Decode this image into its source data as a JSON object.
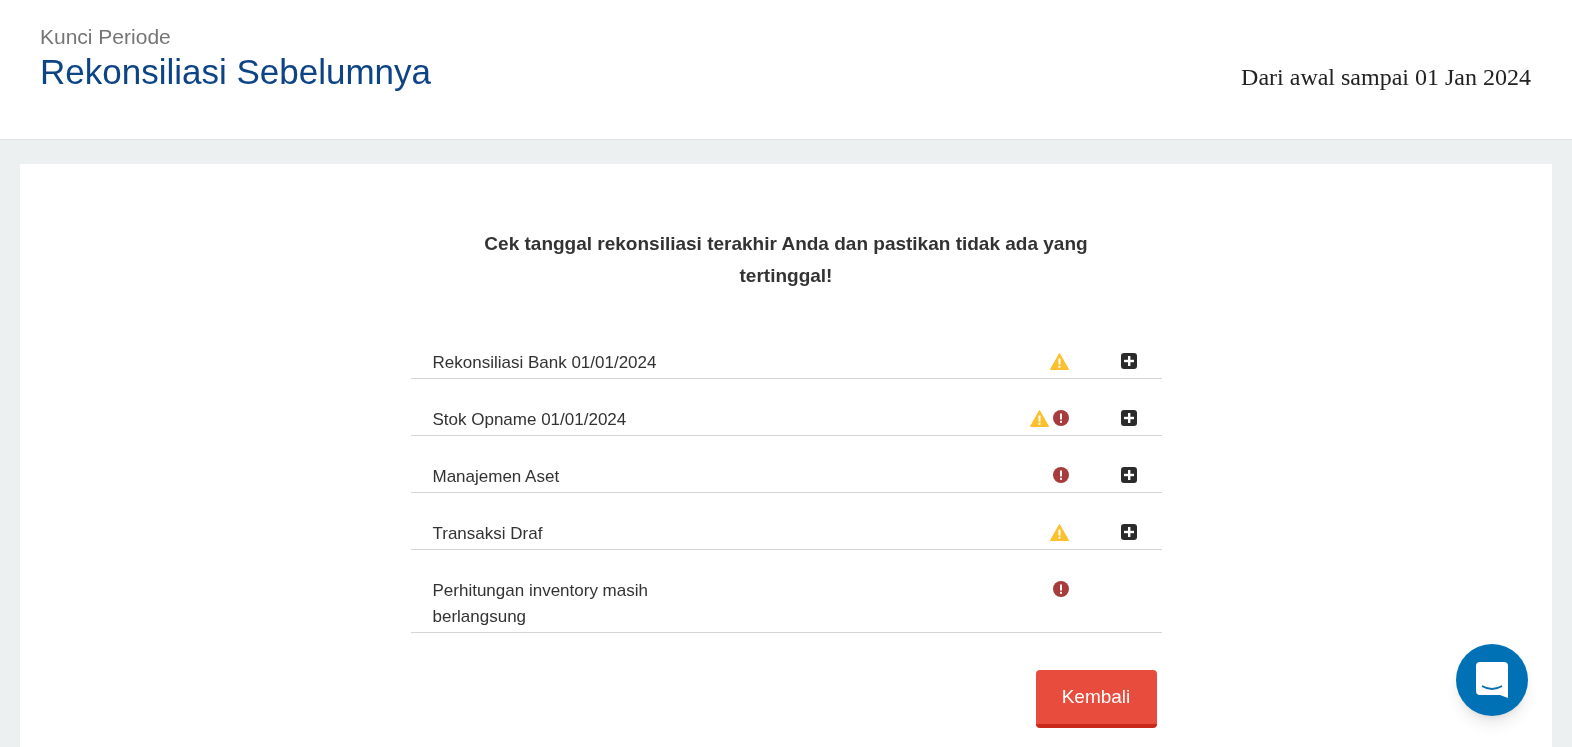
{
  "header": {
    "subtitle": "Kunci Periode",
    "title": "Rekonsiliasi Sebelumnya",
    "date_range": "Dari awal sampai 01 Jan 2024"
  },
  "message": "Cek tanggal rekonsiliasi terakhir Anda dan pastikan tidak ada yang tertinggal!",
  "items": [
    {
      "label": "Rekonsiliasi Bank 01/01/2024",
      "warning": true,
      "error": false,
      "expandable": true
    },
    {
      "label": "Stok Opname 01/01/2024",
      "warning": true,
      "error": true,
      "expandable": true
    },
    {
      "label": "Manajemen Aset",
      "warning": false,
      "error": true,
      "expandable": true
    },
    {
      "label": "Transaksi Draf",
      "warning": true,
      "error": false,
      "expandable": true
    },
    {
      "label": "Perhitungan inventory masih berlangsung",
      "warning": false,
      "error": true,
      "expandable": false
    }
  ],
  "back_button": "Kembali"
}
